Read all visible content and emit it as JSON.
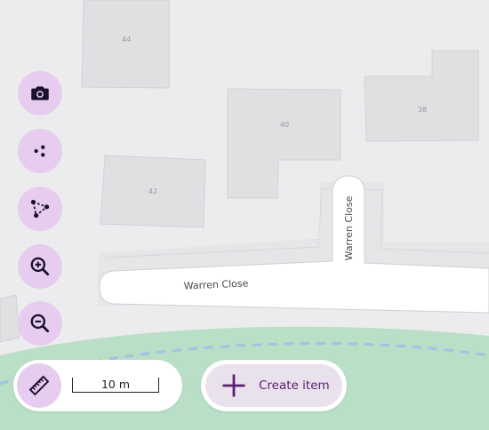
{
  "map": {
    "street_name_horizontal": "Warren Close",
    "street_name_vertical": "Warren Close",
    "house_numbers": {
      "h44": "44",
      "h40": "40",
      "h38": "38",
      "h42": "42"
    },
    "colors": {
      "background": "#ececef",
      "building_fill": "#e0e0e3",
      "building_stroke": "#d2d2d6",
      "road": "#ffffff",
      "park": "#b9dfc6",
      "path": "#9ec4e6",
      "accent": "#5a1f74",
      "fab": "#e6cdef"
    }
  },
  "toolbar": {
    "buttons": [
      {
        "name": "camera",
        "icon": "camera-icon"
      },
      {
        "name": "share",
        "icon": "share-dots-icon"
      },
      {
        "name": "measure-area",
        "icon": "polygon-icon"
      },
      {
        "name": "zoom-in",
        "icon": "zoom-in-icon"
      },
      {
        "name": "zoom-out",
        "icon": "zoom-out-icon"
      }
    ]
  },
  "scale": {
    "label": "10 m",
    "icon": "ruler-icon"
  },
  "create": {
    "label": "Create item",
    "icon": "plus-icon"
  }
}
